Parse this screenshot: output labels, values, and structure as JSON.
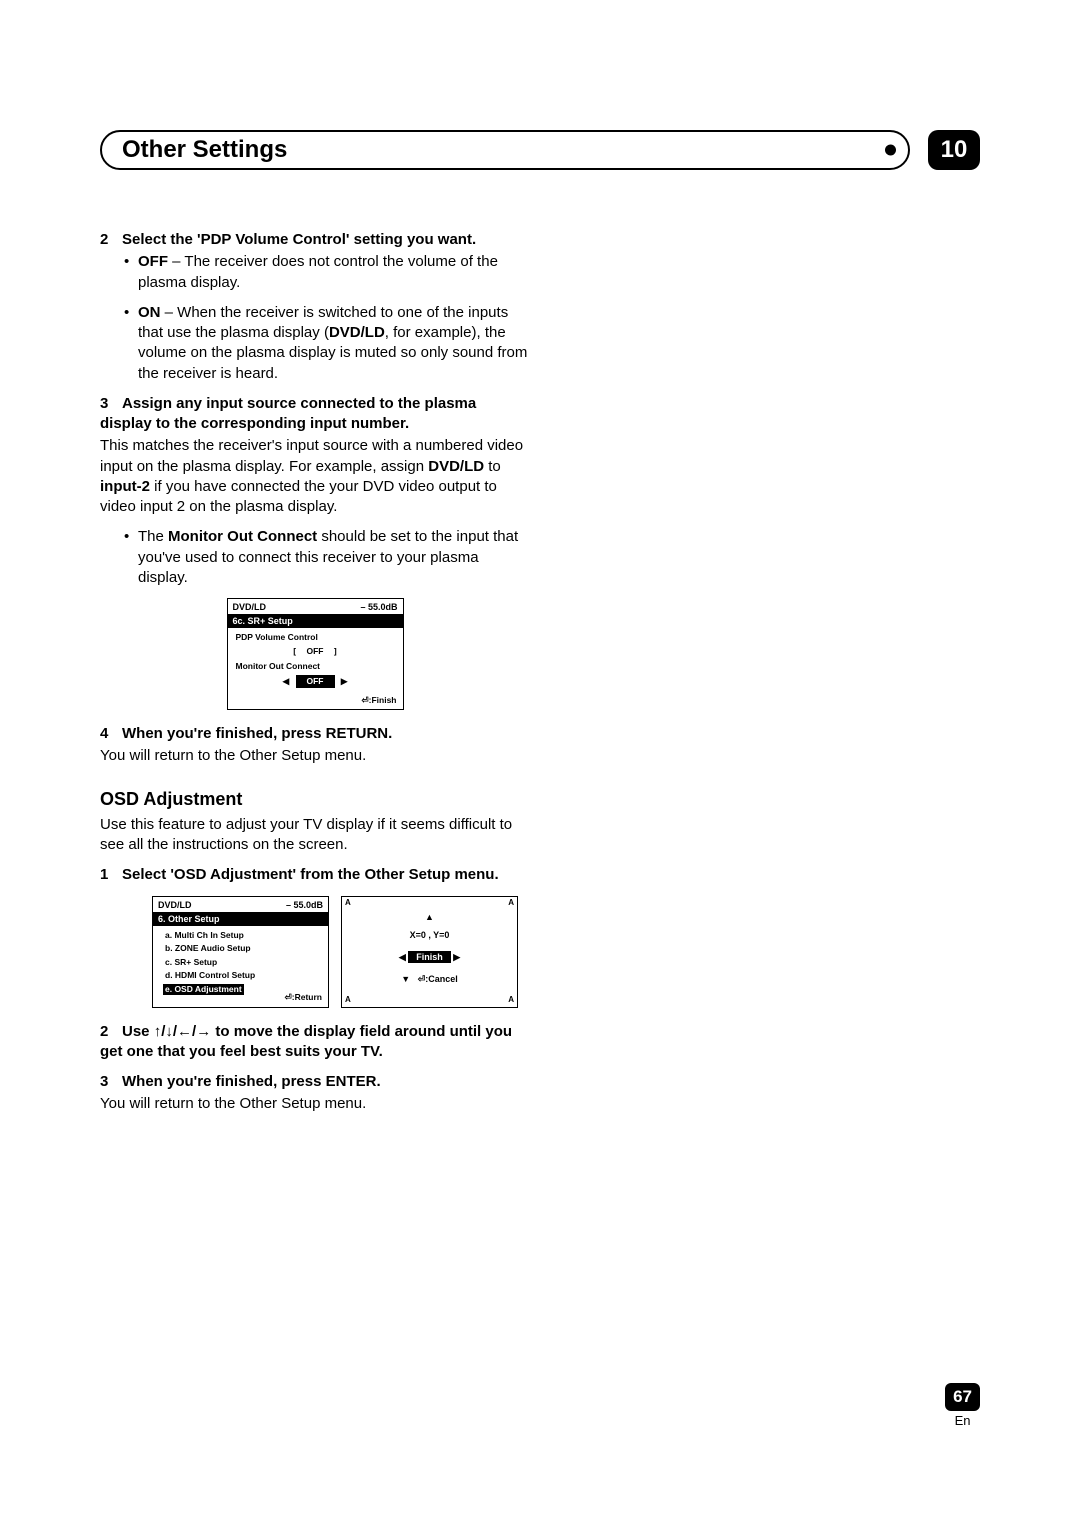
{
  "chapter": {
    "title": "Other Settings",
    "number": "10"
  },
  "step2": {
    "num": "2",
    "title": "Select the 'PDP Volume Control' setting you want.",
    "off_label": "OFF",
    "off_text": " – The receiver does not control the volume of the plasma display.",
    "on_label": "ON",
    "on_text_1": " – When the receiver is switched to one of the inputs that use the plasma display (",
    "on_bold": "DVD/LD",
    "on_text_2": ", for example), the volume on the plasma display is muted so only sound from the receiver is heard."
  },
  "step3": {
    "num": "3",
    "title": "Assign any input source connected to the plasma display to the corresponding input number.",
    "body_1": "This matches the receiver's input source with a numbered video input on the plasma display. For example, assign ",
    "bold_1": "DVD/LD",
    "body_2": " to ",
    "bold_2": "input-2",
    "body_3": " if you have connected the your DVD video output to video input 2 on the plasma display.",
    "bullet_1a": "The ",
    "bullet_bold": "Monitor Out Connect",
    "bullet_1b": " should be set to the input that you've used to connect this receiver to your plasma display."
  },
  "osd1": {
    "top_left": "DVD/LD",
    "top_right": "– 55.0dB",
    "bar": "6c. SR+ Setup",
    "l1": "PDP Volume Control",
    "off": "OFF",
    "l2": "Monitor Out Connect",
    "off2": "OFF",
    "footer": "⏎:Finish",
    "left_br": "[",
    "right_br": "]",
    "tri_l": "◀",
    "tri_r": "▶"
  },
  "step4": {
    "num": "4",
    "title": "When you're finished, press RETURN.",
    "body": "You will return to the Other Setup menu."
  },
  "osdadj": {
    "heading": "OSD Adjustment",
    "intro": "Use this feature to adjust your TV display if it seems difficult to see all the instructions on the screen.",
    "s1_num": "1",
    "s1_title": "Select 'OSD Adjustment' from the Other Setup menu."
  },
  "osd2a": {
    "top_left": "DVD/LD",
    "top_right": "– 55.0dB",
    "bar": "6. Other Setup",
    "a": "a. Multi Ch In Setup",
    "b": "b. ZONE Audio Setup",
    "c": "c. SR+ Setup",
    "d": "d. HDMI Control Setup",
    "e_bar": "e. OSD Adjustment",
    "footer": "⏎:Return"
  },
  "osd2b": {
    "corner": "A",
    "up": "▲",
    "coords": "X=0 , Y=0",
    "left": "◀",
    "finish": "Finish",
    "right": "▶",
    "down": "▼",
    "cancel": "⏎:Cancel"
  },
  "step_arrows": {
    "num": "2",
    "pre": "Use ",
    "arrows": "↑/↓/←/→",
    "post": " to move the display field around until you get one that you feel best suits your TV."
  },
  "step_enter": {
    "num": "3",
    "title": "When you're finished, press ENTER.",
    "body": "You will return to the Other Setup menu."
  },
  "footer": {
    "page": "67",
    "lang": "En"
  }
}
